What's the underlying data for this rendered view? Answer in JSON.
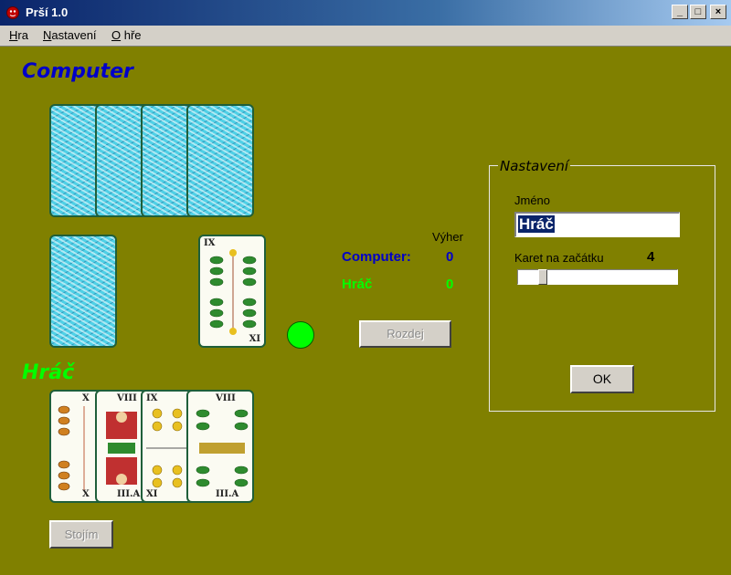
{
  "window": {
    "title": "Prší 1.0",
    "minimize": "_",
    "maximize": "□",
    "close": "×"
  },
  "menu": [
    {
      "underline": "H",
      "rest": "ra"
    },
    {
      "underline": "N",
      "rest": "astavení"
    },
    {
      "underline": "O",
      "rest": " hře"
    }
  ],
  "computer": {
    "heading": "Computer",
    "hand_count": 4
  },
  "player": {
    "heading": "Hráč",
    "cards": [
      {
        "top": "X",
        "bottom": "X"
      },
      {
        "top": "VIII",
        "bottom": "III.A"
      },
      {
        "top": "IX",
        "bottom": "XI"
      },
      {
        "top": "VIII",
        "bottom": "III.A"
      }
    ]
  },
  "table": {
    "top_card": {
      "top": "IX",
      "bottom": "XI"
    }
  },
  "scores": {
    "header": "Výher",
    "computer_label": "Computer:",
    "computer_value": "0",
    "player_label": "Hráč",
    "player_value": "0"
  },
  "buttons": {
    "deal": "Rozdej",
    "stand": "Stojím",
    "ok": "OK"
  },
  "settings": {
    "title": "Nastavení",
    "name_label": "Jméno",
    "name_value": "Hráč",
    "cards_label": "Karet na začátku",
    "cards_value": "4",
    "slider_fraction": 0.1
  },
  "colors": {
    "background": "#808000",
    "computer": "#0000c8",
    "player": "#00ff00",
    "indicator": "#00ff00"
  }
}
